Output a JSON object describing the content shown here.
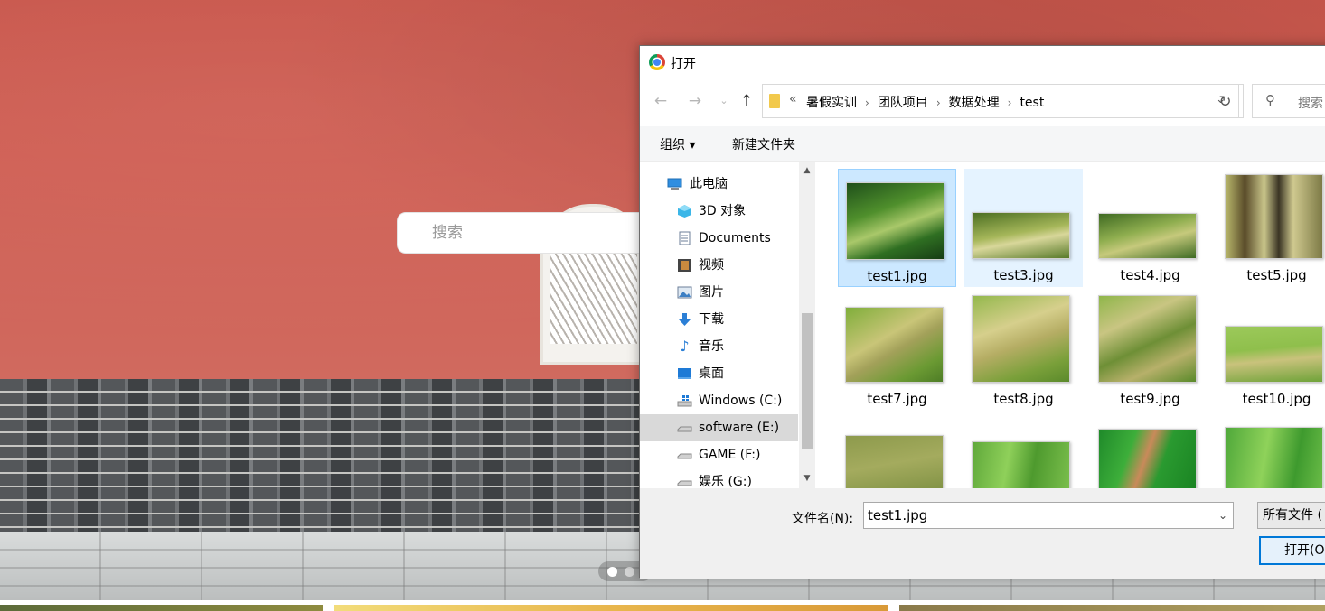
{
  "background_page": {
    "search_placeholder": "搜索"
  },
  "dialog": {
    "title": "打开",
    "address": {
      "overflow": "«",
      "crumbs": [
        "暑假实训",
        "团队项目",
        "数据处理",
        "test"
      ]
    },
    "search_placeholder": "搜索",
    "toolbar": {
      "organize": "组织 ▾",
      "new_folder": "新建文件夹"
    },
    "nav": [
      {
        "label": "此电脑",
        "icon": "computer-icon"
      },
      {
        "label": "3D 对象",
        "icon": "cube-icon"
      },
      {
        "label": "Documents",
        "icon": "document-icon"
      },
      {
        "label": "视频",
        "icon": "film-icon"
      },
      {
        "label": "图片",
        "icon": "image-icon"
      },
      {
        "label": "下载",
        "icon": "download-arrow-icon"
      },
      {
        "label": "音乐",
        "icon": "music-note-icon"
      },
      {
        "label": "桌面",
        "icon": "desktop-icon"
      },
      {
        "label": "Windows (C:)",
        "icon": "drive-windows-icon"
      },
      {
        "label": "software (E:)",
        "icon": "drive-icon",
        "selected": true
      },
      {
        "label": "GAME (F:)",
        "icon": "drive-icon"
      },
      {
        "label": "娱乐 (G:)",
        "icon": "drive-icon"
      }
    ],
    "files": [
      {
        "name": "test1.jpg",
        "state": "selected"
      },
      {
        "name": "test3.jpg",
        "state": "hover"
      },
      {
        "name": "test4.jpg",
        "state": ""
      },
      {
        "name": "test5.jpg",
        "state": ""
      },
      {
        "name": "test7.jpg",
        "state": ""
      },
      {
        "name": "test8.jpg",
        "state": ""
      },
      {
        "name": "test9.jpg",
        "state": ""
      },
      {
        "name": "test10.jpg",
        "state": ""
      },
      {
        "name": "",
        "state": ""
      },
      {
        "name": "",
        "state": ""
      },
      {
        "name": "",
        "state": ""
      },
      {
        "name": "",
        "state": ""
      }
    ],
    "filename_label": "文件名(N):",
    "filename_value": "test1.jpg",
    "filetype_value": "所有文件 (",
    "open_label": "打开(O"
  },
  "colors": {
    "wall_red": "#cf5d52",
    "selection_fill": "#cce8ff",
    "selection_border": "#99d1ff",
    "accent_blue": "#0078d7"
  }
}
